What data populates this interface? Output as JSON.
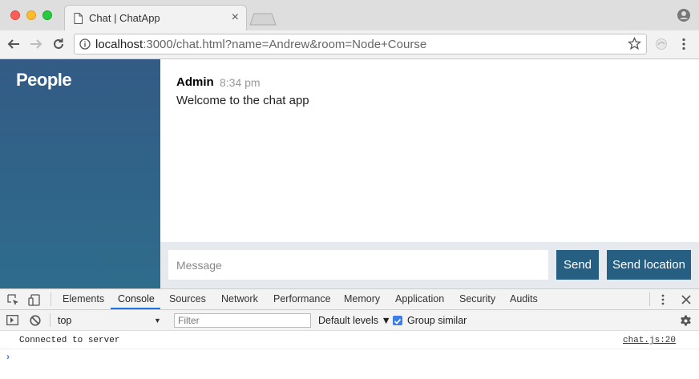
{
  "browser": {
    "tab": {
      "title": "Chat | ChatApp",
      "doc_icon": "document-icon",
      "close_glyph": "×"
    },
    "address": {
      "host": "localhost",
      "rest": ":3000/chat.html?name=Andrew&room=Node+Course"
    }
  },
  "sidebar": {
    "title": "People"
  },
  "messages": [
    {
      "from": "Admin",
      "time": "8:34 pm",
      "text": "Welcome to the chat app"
    }
  ],
  "composer": {
    "placeholder": "Message",
    "send_label": "Send",
    "location_label": "Send location"
  },
  "devtools": {
    "tabs": [
      "Elements",
      "Console",
      "Sources",
      "Network",
      "Performance",
      "Memory",
      "Application",
      "Security",
      "Audits"
    ],
    "active_tab": "Console",
    "context": "top",
    "filter_placeholder": "Filter",
    "levels_label": "Default levels ▼",
    "group_similar_label": "Group similar",
    "group_similar_checked": true,
    "logs": [
      {
        "text": "Connected to server",
        "source": "chat.js:20"
      }
    ],
    "prompt_glyph": "›"
  },
  "colors": {
    "sidebar_top": "#335b85",
    "sidebar_bottom": "#2e6c8c",
    "button": "#265f82",
    "accent": "#1a73e8"
  }
}
